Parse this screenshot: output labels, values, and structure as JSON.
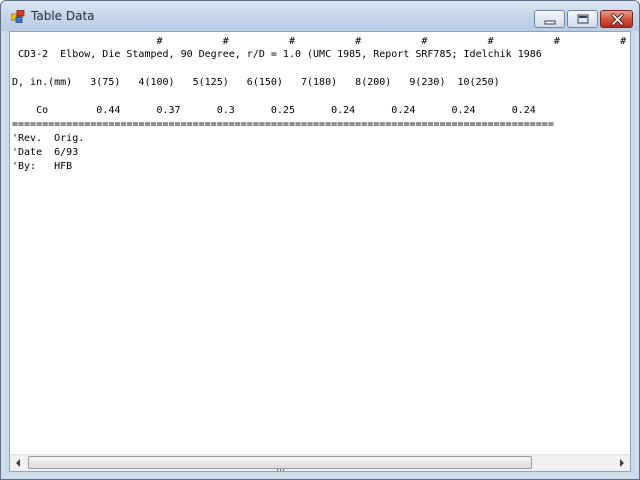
{
  "window": {
    "title": "Table Data"
  },
  "content": {
    "lines": [
      "                        #          #          #          #          #          #          #          #",
      " CD3-2  Elbow, Die Stamped, 90 Degree, r/D = 1.0 (UMC 1985, Report SRF785; Idelchik 1986",
      "D, in.(mm)   3(75)   4(100)   5(125)   6(150)   7(180)   8(200)   9(230)  10(250)",
      "    Co        0.44      0.37      0.3      0.25      0.24      0.24      0.24      0.24",
      "==========================================================================================",
      "'Rev.  Orig.",
      "'Date  6/93",
      "'By:   HFB"
    ]
  },
  "scrollbar": {
    "grip": "III"
  },
  "icons": {
    "app": "table-icon",
    "minimize": "minimize-icon",
    "maximize": "maximize-icon",
    "close": "close-icon"
  }
}
